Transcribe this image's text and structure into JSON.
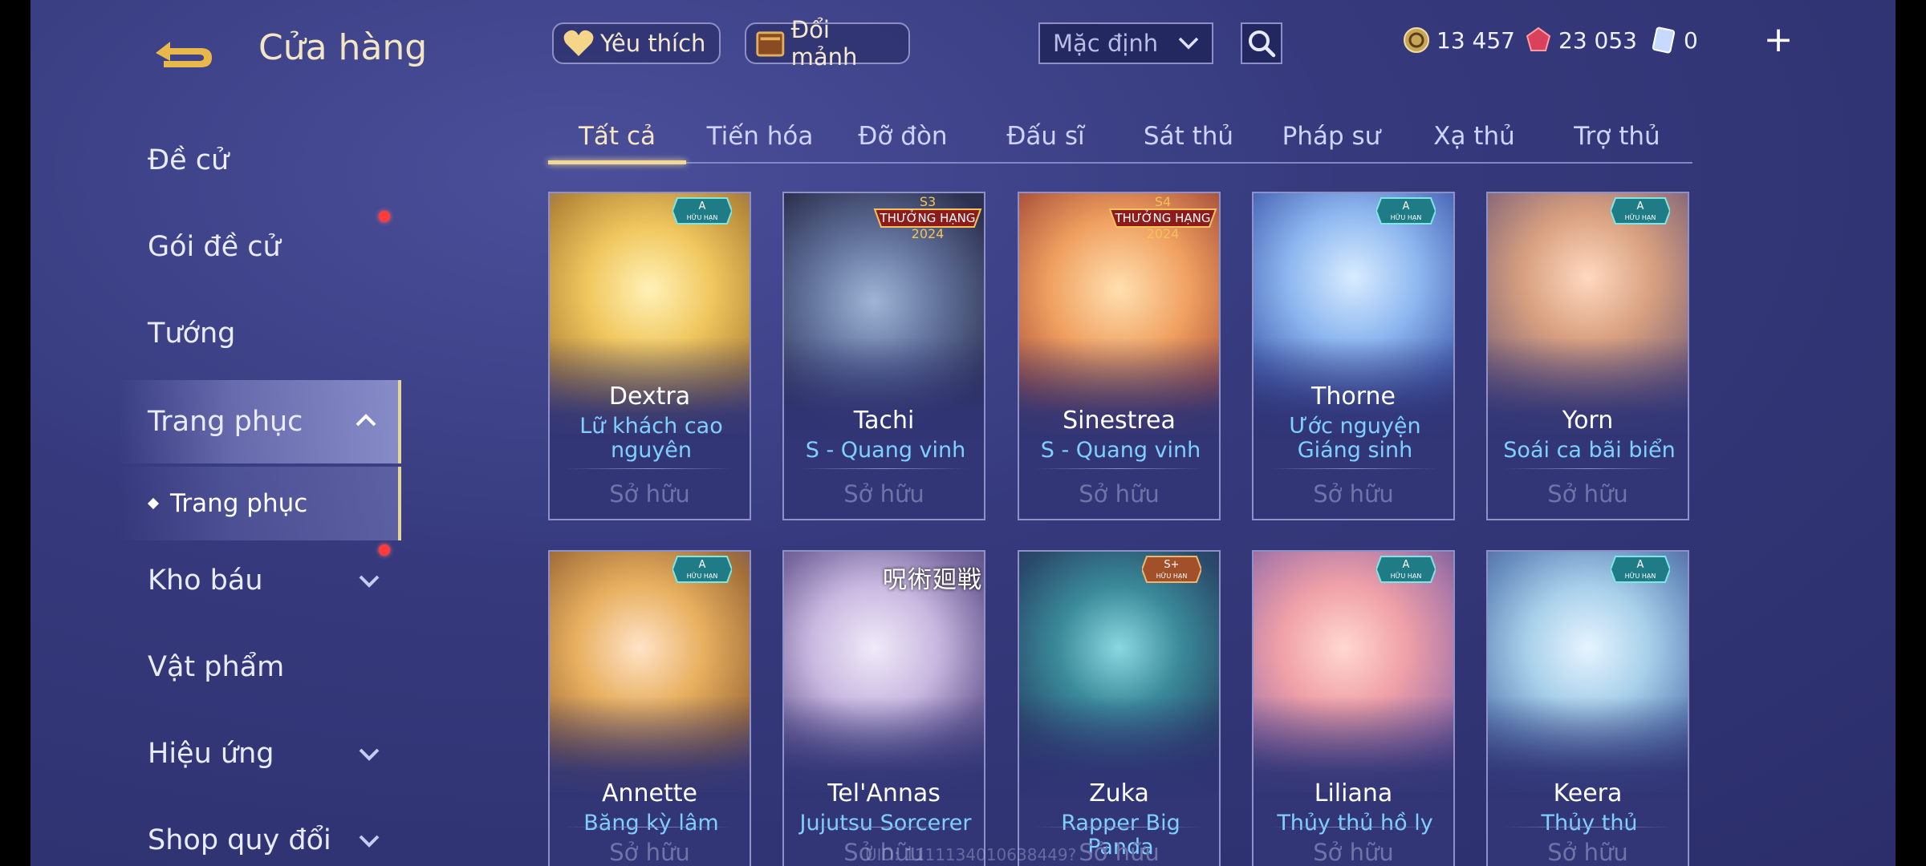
{
  "header": {
    "title": "Cửa hàng",
    "favorites_label": "Yêu thích",
    "exchange_label": "Đổi mảnh",
    "sort_label": "Mặc định",
    "currencies": [
      {
        "name": "vouchers",
        "icon": "coin-icon",
        "value": "13 457"
      },
      {
        "name": "gems",
        "icon": "red-gem-icon",
        "value": "23 053"
      },
      {
        "name": "cards",
        "icon": "card-icon",
        "value": "0"
      }
    ],
    "add_label": "+"
  },
  "sidebar": {
    "items": [
      {
        "label": "Đề cử"
      },
      {
        "label": "Gói đề cử"
      },
      {
        "label": "Tướng"
      },
      {
        "label": "Trang phục"
      },
      {
        "label": "Kho báu"
      },
      {
        "label": "Vật phẩm"
      },
      {
        "label": "Hiệu ứng"
      },
      {
        "label": "Shop quy đổi"
      }
    ],
    "sub_item": "Trang phục"
  },
  "tabs": [
    "Tất cả",
    "Tiến hóa",
    "Đỡ đòn",
    "Đấu sĩ",
    "Sát thủ",
    "Pháp sư",
    "Xạ thủ",
    "Trợ thủ"
  ],
  "cards": [
    {
      "hero": "Dextra",
      "skin": "Lữ khách cao nguyên",
      "status": "Sở hữu"
    },
    {
      "hero": "Tachi",
      "skin": "S - Quang vinh",
      "status": "Sở hữu",
      "rank": "THƯỞNG HẠNG",
      "year": "2024",
      "season": "S3"
    },
    {
      "hero": "Sinestrea",
      "skin": "S - Quang vinh",
      "status": "Sở hữu",
      "rank": "THƯỞNG HẠNG",
      "year": "2024",
      "season": "S4"
    },
    {
      "hero": "Thorne",
      "skin": "Ước nguyện Giáng sinh",
      "status": "Sở hữu"
    },
    {
      "hero": "Yorn",
      "skin": "Soái ca bãi biển",
      "status": "Sở hữu"
    },
    {
      "hero": "Annette",
      "skin": "Băng kỳ lâm",
      "status": "Sở hữu"
    },
    {
      "hero": "Tel'Annas",
      "skin": "Jujutsu Sorcerer",
      "status": "Sở hữu",
      "logo": "呪術廻戦"
    },
    {
      "hero": "Zuka",
      "skin": "Rapper Big Panda",
      "status": "Sở hữu"
    },
    {
      "hero": "Liliana",
      "skin": "Thủy thủ hồ ly",
      "status": "Sở hữu"
    },
    {
      "hero": "Keera",
      "skin": "Thủy thủ",
      "status": "Sở hữu"
    }
  ],
  "badges": {
    "a": "A",
    "s_plus": "S+",
    "limited": "HỮU HẠN"
  },
  "watermark": "UID: 1111134010638449?",
  "colors": {
    "accent_gold": "#f1d89a",
    "skin_text": "#7fd0ff",
    "owned_text": "#6f73a8",
    "notification": "#ff3b3b"
  }
}
